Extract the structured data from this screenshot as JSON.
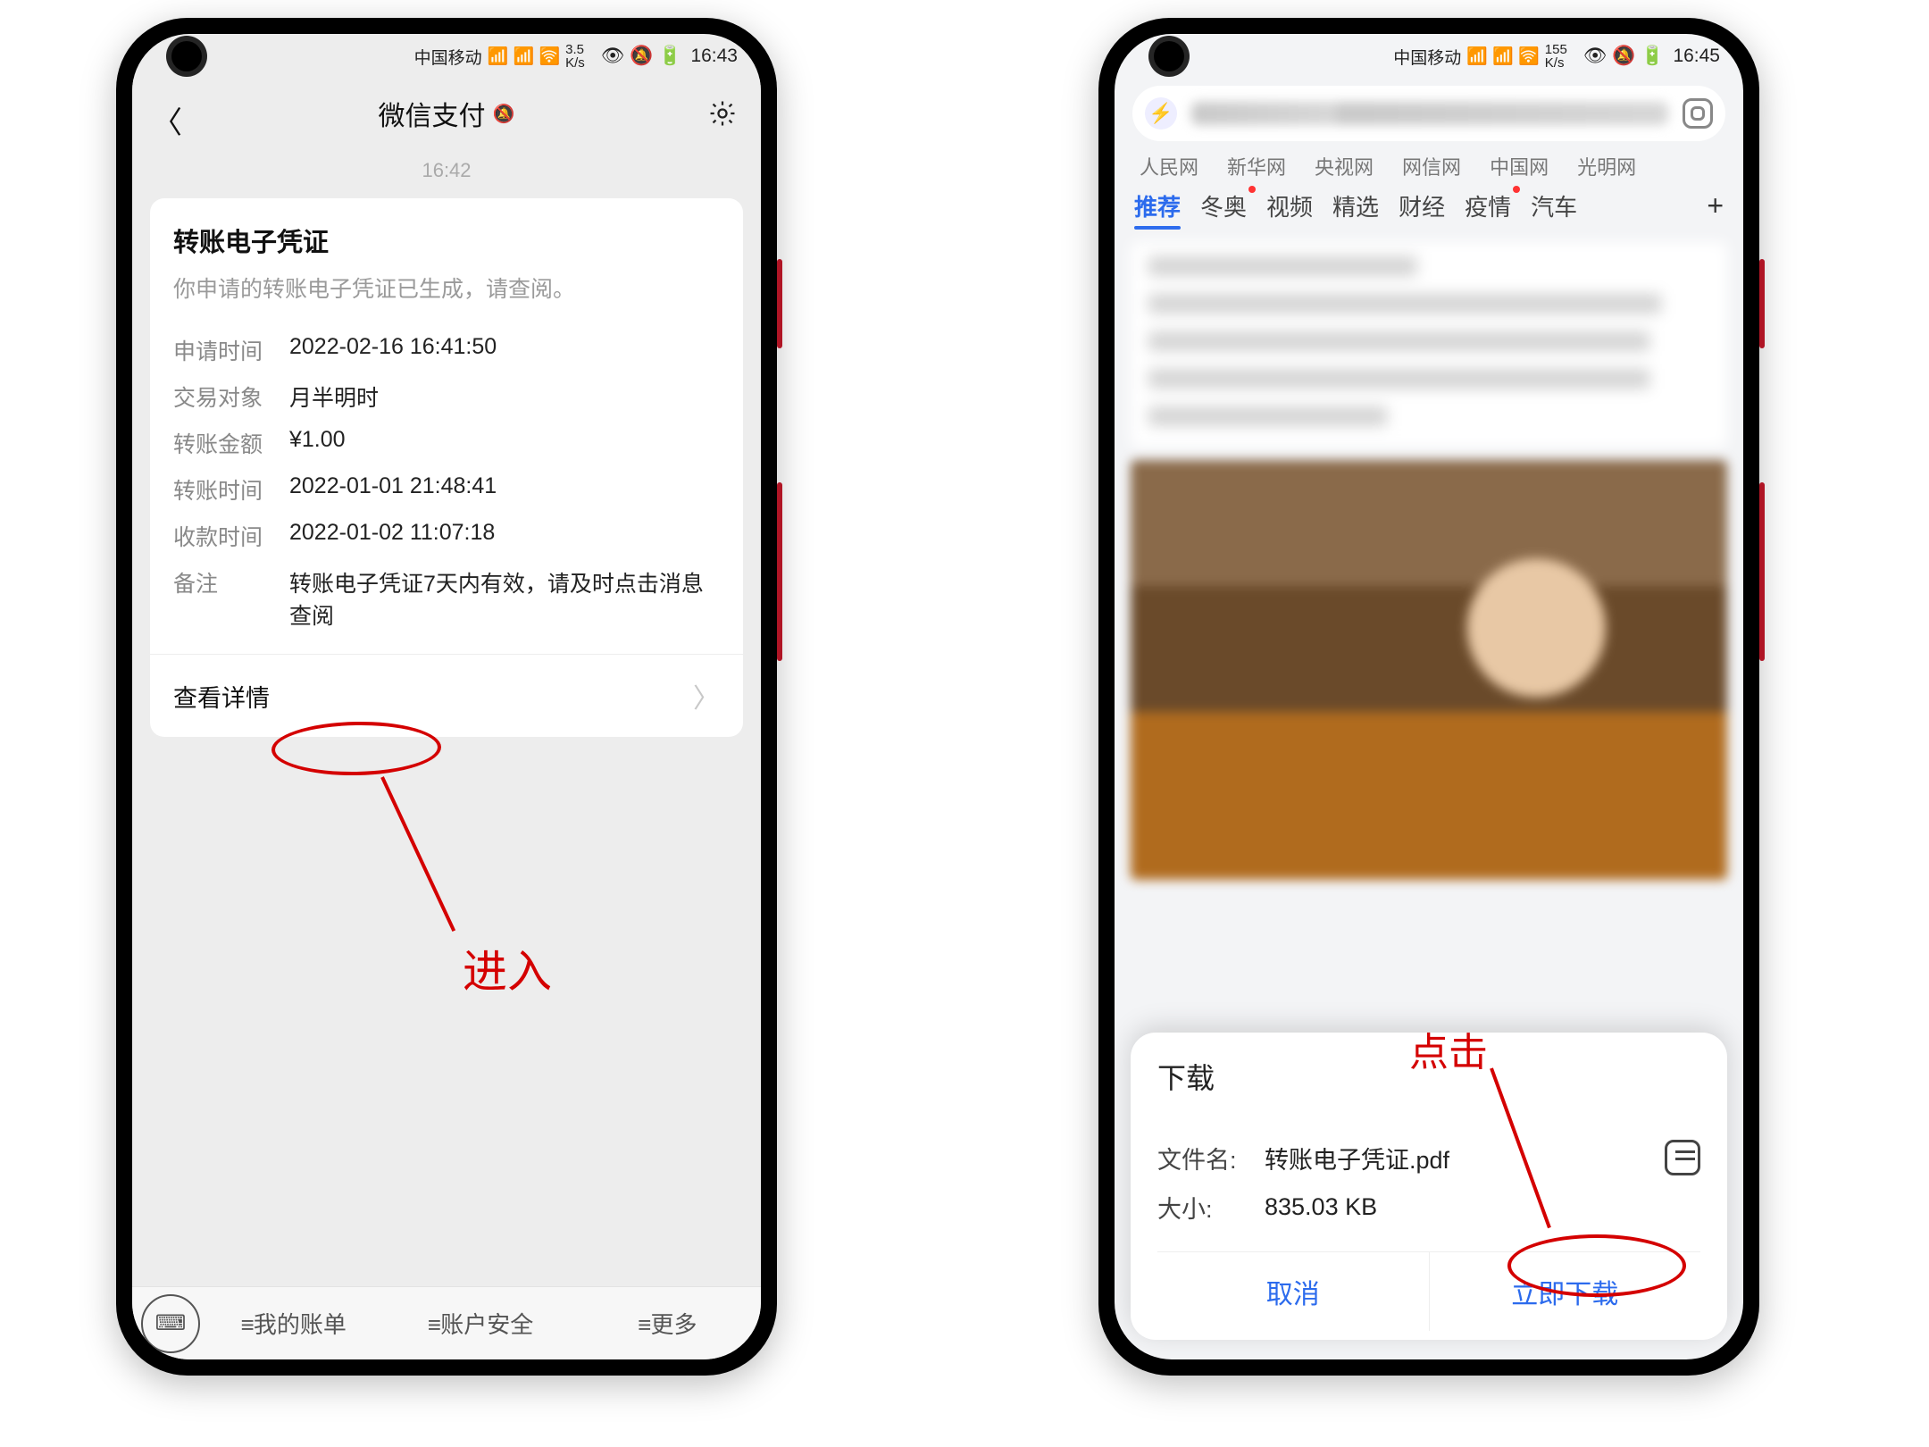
{
  "left": {
    "status": {
      "carrier": "中国移动",
      "net": "HD ⁴⁶ ₐᵢₗₗ 🜲",
      "rate": "3.5\nK/s",
      "icons": "👁 🔕 ▢94▢ ⚡",
      "time": "16:43"
    },
    "header": {
      "title": "微信支付",
      "mute": "🔕"
    },
    "msg_time": "16:42",
    "card": {
      "title": "转账电子凭证",
      "subtitle": "你申请的转账电子凭证已生成，请查阅。",
      "rows": {
        "apply_label": "申请时间",
        "apply_value": "2022-02-16 16:41:50",
        "party_label": "交易对象",
        "party_value": "月半明时",
        "amount_label": "转账金额",
        "amount_value": "¥1.00",
        "transfer_label": "转账时间",
        "transfer_value": "2022-01-01 21:48:41",
        "receive_label": "收款时间",
        "receive_value": "2022-01-02 11:07:18",
        "note_label": "备注",
        "note_value": "转账电子凭证7天内有效，请及时点击消息查阅"
      },
      "detail": "查看详情"
    },
    "footer": {
      "bill": "我的账单",
      "security": "账户安全",
      "more": "更多"
    },
    "annotation": "进入"
  },
  "right": {
    "status": {
      "carrier": "中国移动",
      "net": "HD ⁴⁶ ₐᵢₗₗ 🜲",
      "rate": "155\nK/s",
      "icons": "👁 🔕 ▢94▢ ⚡",
      "time": "16:45"
    },
    "sites": [
      "人民网",
      "新华网",
      "央视网",
      "网信网",
      "中国网",
      "光明网"
    ],
    "tabs": {
      "items": [
        "推荐",
        "冬奥",
        "视频",
        "精选",
        "财经",
        "疫情",
        "汽车"
      ],
      "plus": "+"
    },
    "sheet": {
      "title": "下载",
      "filename_label": "文件名:",
      "filename_value": "转账电子凭证.pdf",
      "size_label": "大小:",
      "size_value": "835.03 KB",
      "cancel": "取消",
      "download": "立即下载"
    },
    "annotation": "点击"
  }
}
